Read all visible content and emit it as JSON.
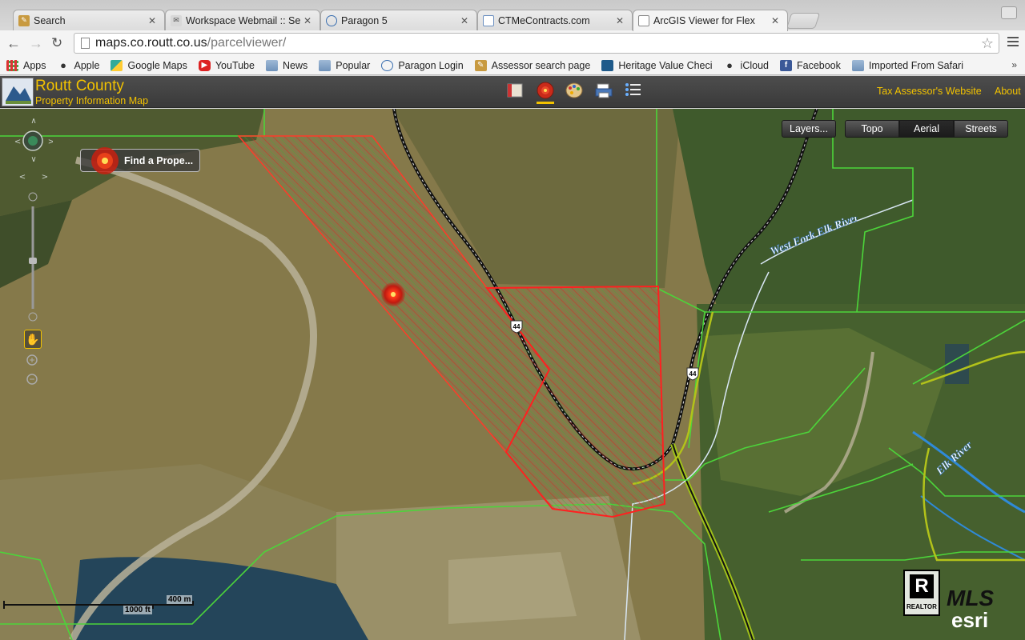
{
  "browser": {
    "tabs": [
      {
        "title": "Search",
        "favicon": "search-page-icon"
      },
      {
        "title": "Workspace Webmail :: Sear",
        "favicon": "webmail-icon"
      },
      {
        "title": "Paragon 5",
        "favicon": "paragon-icon"
      },
      {
        "title": "CTMeContracts.com",
        "favicon": "doc-icon"
      },
      {
        "title": "ArcGIS Viewer for Flex",
        "favicon": "page-icon"
      }
    ],
    "url_host": "maps.co.routt.co.us",
    "url_path": "/parcelviewer/",
    "bookmarks": [
      {
        "label": "Apps",
        "icon": "apps-grid-icon"
      },
      {
        "label": "Apple",
        "icon": "apple-icon"
      },
      {
        "label": "Google Maps",
        "icon": "google-maps-icon"
      },
      {
        "label": "YouTube",
        "icon": "youtube-icon"
      },
      {
        "label": "News",
        "icon": "folder-icon"
      },
      {
        "label": "Popular",
        "icon": "folder-icon"
      },
      {
        "label": "Paragon Login",
        "icon": "paragon-icon"
      },
      {
        "label": "Assessor search page",
        "icon": "assessor-icon"
      },
      {
        "label": "Heritage Value Checi",
        "icon": "heritage-icon"
      },
      {
        "label": "iCloud",
        "icon": "apple-icon"
      },
      {
        "label": "Facebook",
        "icon": "facebook-icon"
      },
      {
        "label": "Imported From Safari",
        "icon": "folder-icon"
      }
    ],
    "bookmarks_overflow": "»"
  },
  "app": {
    "title": "Routt County",
    "subtitle": "Property Information Map",
    "tax_link": "Tax Assessor's Website",
    "about_link": "About",
    "accent": "#f2c200"
  },
  "map": {
    "layers_button": "Layers...",
    "basemaps": [
      "Topo",
      "Aerial",
      "Streets"
    ],
    "selected_basemap": "Aerial",
    "find_button": "Find a Prope...",
    "road_label_1": "44",
    "road_label_2": "44",
    "river_label_1": "West Fork Elk River",
    "river_label_2": "Elk River",
    "scale_m": "400 m",
    "scale_ft": "1000 ft",
    "parcel_color": "#e02020",
    "parcel_line_color": "#4cd43a"
  },
  "attribution": {
    "realtor_text": "REALTOR",
    "mls_text": "MLS",
    "esri_text": "esri"
  }
}
